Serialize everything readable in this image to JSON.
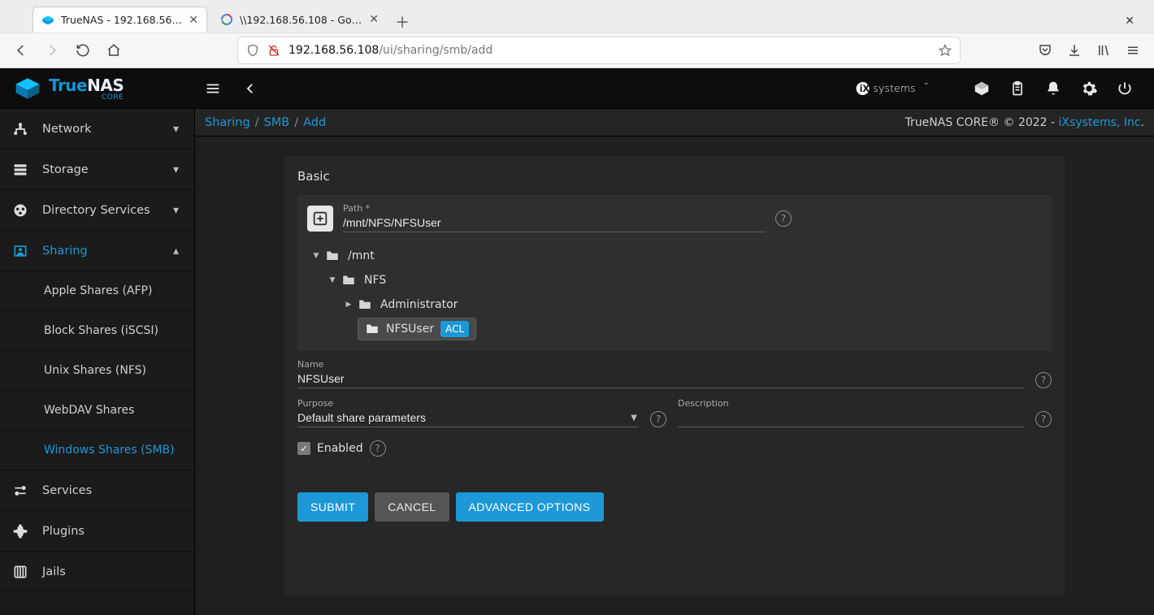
{
  "browser": {
    "tabs": [
      {
        "title": "TrueNAS - 192.168.56.108",
        "active": true,
        "favicon": "truenas"
      },
      {
        "title": "\\\\192.168.56.108 - Google",
        "active": false,
        "favicon": "google"
      }
    ],
    "url_host": "192.168.56.108",
    "url_path": "/ui/sharing/smb/add"
  },
  "header": {
    "product": "TrueNAS",
    "edition": "CORE",
    "brand": "iXsystems"
  },
  "breadcrumbs": {
    "items": [
      "Sharing",
      "SMB",
      "Add"
    ],
    "right_text": "TrueNAS CORE® © 2022 - ",
    "right_link": "iXsystems, Inc"
  },
  "sidebar": {
    "items": [
      {
        "label": "Network",
        "icon": "network",
        "expandable": true
      },
      {
        "label": "Storage",
        "icon": "storage",
        "expandable": true
      },
      {
        "label": "Directory Services",
        "icon": "dirsvc",
        "expandable": true
      },
      {
        "label": "Sharing",
        "icon": "sharing",
        "expandable": true,
        "active": true,
        "expanded": true,
        "children": [
          {
            "label": "Apple Shares (AFP)"
          },
          {
            "label": "Block Shares (iSCSI)"
          },
          {
            "label": "Unix Shares (NFS)"
          },
          {
            "label": "WebDAV Shares"
          },
          {
            "label": "Windows Shares (SMB)",
            "active": true
          }
        ]
      },
      {
        "label": "Services",
        "icon": "services"
      },
      {
        "label": "Plugins",
        "icon": "plugins"
      },
      {
        "label": "Jails",
        "icon": "jails"
      }
    ]
  },
  "form": {
    "section_title": "Basic",
    "path": {
      "label": "Path *",
      "value": "/mnt/NFS/NFSUser"
    },
    "tree": {
      "root": "/mnt",
      "l1": "NFS",
      "l2a": "Administrator",
      "l2b": "NFSUser",
      "acl_badge": "ACL"
    },
    "name": {
      "label": "Name",
      "value": "NFSUser"
    },
    "purpose": {
      "label": "Purpose",
      "value": "Default share parameters"
    },
    "description": {
      "label": "Description",
      "value": ""
    },
    "enabled": {
      "label": "Enabled",
      "checked": true
    },
    "buttons": {
      "submit": "SUBMIT",
      "cancel": "CANCEL",
      "advanced": "ADVANCED OPTIONS"
    }
  }
}
